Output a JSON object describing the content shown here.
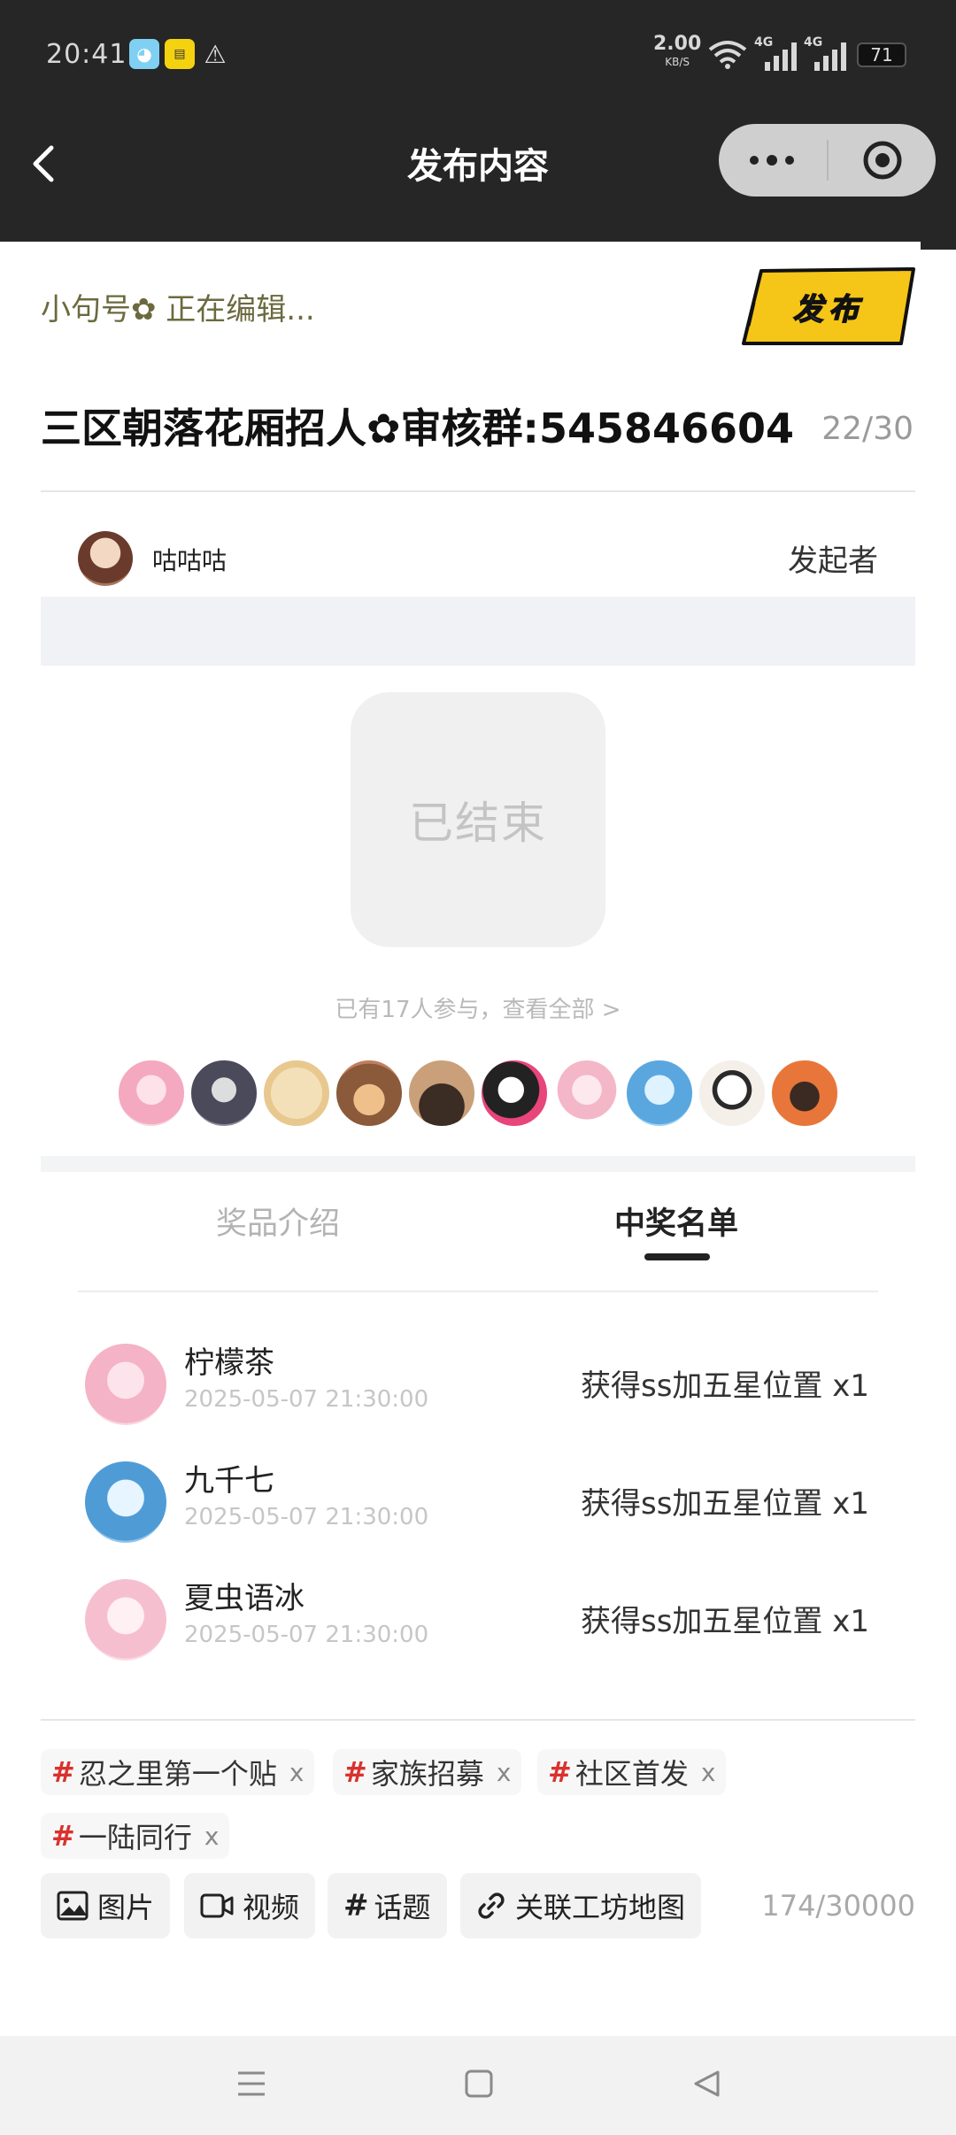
{
  "status_bar": {
    "time": "20:41",
    "net_speed": "2.00",
    "net_unit": "KB/S",
    "signal1": "4G",
    "signal2": "4G",
    "battery": "71"
  },
  "nav": {
    "title": "发布内容"
  },
  "editor": {
    "editing_status": "小句号✿ 正在编辑...",
    "publish_label": "发布",
    "title": "三区朝落花厢招人✿审核群:545846604",
    "title_count": "22/30"
  },
  "lottery": {
    "organizer_name": "咕咕咕",
    "organizer_role": "发起者",
    "status": "已结束",
    "participants_text": "已有17人参与，查看全部 >",
    "tabs": [
      "奖品介绍",
      "中奖名单"
    ],
    "active_tab": 1,
    "winners": [
      {
        "name": "柠檬茶",
        "time": "2025-05-07 21:30:00",
        "prize": "获得ss加五星位置 x1"
      },
      {
        "name": "九千七",
        "time": "2025-05-07 21:30:00",
        "prize": "获得ss加五星位置 x1"
      },
      {
        "name": "夏虫语冰",
        "time": "2025-05-07 21:30:00",
        "prize": "获得ss加五星位置 x1"
      }
    ]
  },
  "tags": [
    {
      "hash": "#",
      "label": "忍之里第一个贴",
      "remove": "x"
    },
    {
      "hash": "#",
      "label": "家族招募",
      "remove": "x"
    },
    {
      "hash": "#",
      "label": "社区首发",
      "remove": "x"
    },
    {
      "hash": "#",
      "label": "一陆同行",
      "remove": "x"
    }
  ],
  "toolbar": {
    "image_label": "图片",
    "video_label": "视频",
    "topic_hash": "#",
    "topic_label": "话题",
    "map_label": "关联工坊地图",
    "char_count": "174/30000"
  },
  "colors": {
    "accent_yellow": "#f5c518",
    "hash_red": "#d9322e",
    "dark_bar": "#262626"
  }
}
